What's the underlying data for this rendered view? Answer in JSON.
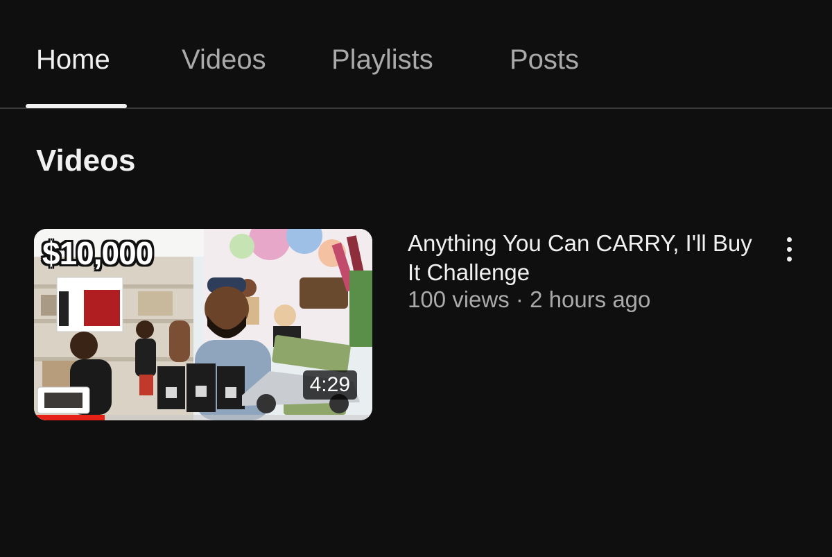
{
  "tabs": [
    {
      "label": "Home",
      "active": true
    },
    {
      "label": "Videos",
      "active": false
    },
    {
      "label": "Playlists",
      "active": false
    },
    {
      "label": "Posts",
      "active": false
    }
  ],
  "section": {
    "title": "Videos"
  },
  "video": {
    "title": "Anything You Can CARRY, I'll Buy It Challenge",
    "views": "100 views",
    "separator": "·",
    "age": "2 hours ago",
    "duration": "4:29",
    "thumbnail_text": "$10,000",
    "watch_progress": 0.21,
    "more_icon": "more-vertical-icon"
  },
  "colors": {
    "background": "#0f0f0f",
    "text_primary": "#f1f1f1",
    "text_secondary": "#aaaaaa",
    "progress": "#e62117"
  }
}
